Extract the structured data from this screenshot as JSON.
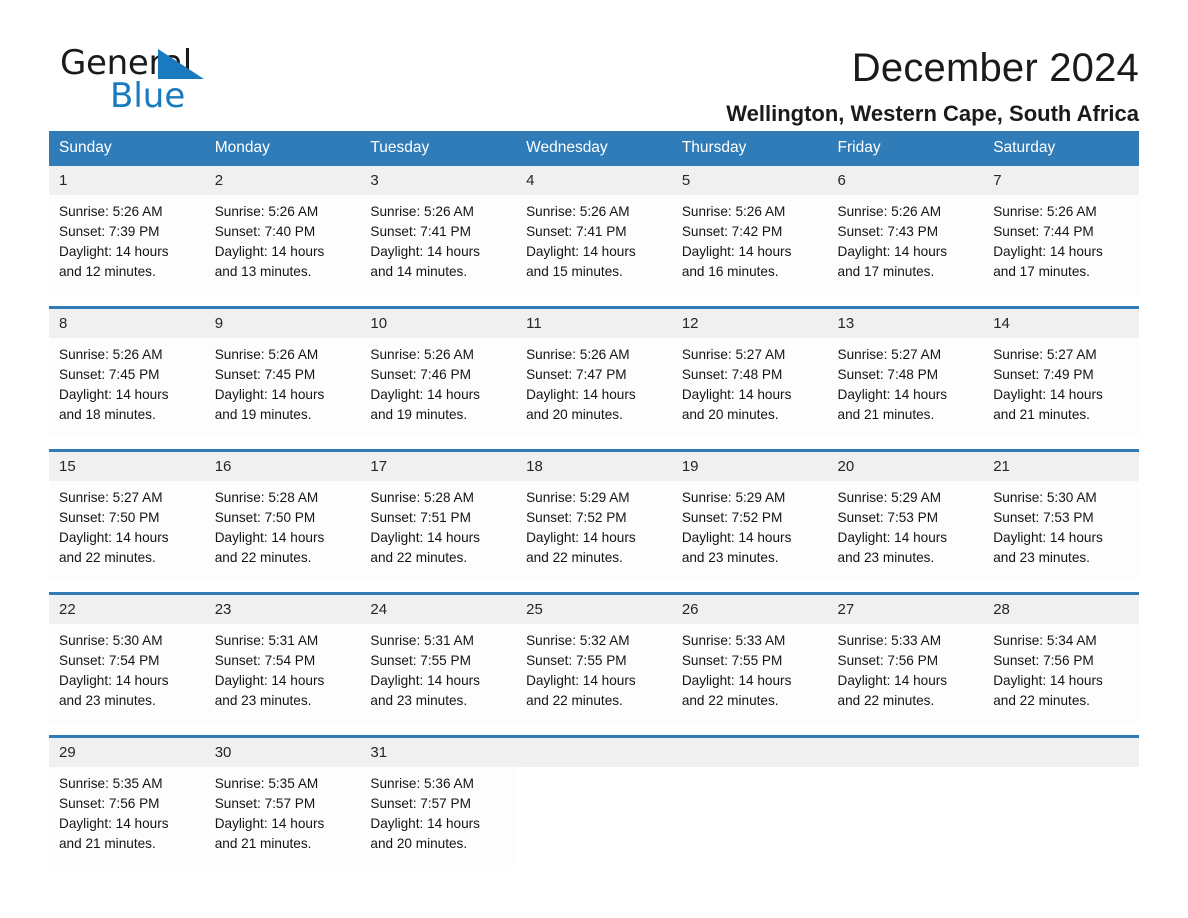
{
  "brand": {
    "name_part1": "General",
    "name_part2": "Blue",
    "logo_icon": "triangle-flag-icon"
  },
  "header": {
    "month_title": "December 2024",
    "location": "Wellington, Western Cape, South Africa"
  },
  "colors": {
    "header_blue": "#2f7cb8",
    "date_band": "#f0f0f0",
    "brand_blue": "#1a7ac0",
    "text": "#141414"
  },
  "weekday_headers": [
    "Sunday",
    "Monday",
    "Tuesday",
    "Wednesday",
    "Thursday",
    "Friday",
    "Saturday"
  ],
  "weeks": [
    {
      "dates": [
        "1",
        "2",
        "3",
        "4",
        "5",
        "6",
        "7"
      ],
      "cells": [
        {
          "sunrise": "Sunrise: 5:26 AM",
          "sunset": "Sunset: 7:39 PM",
          "daylight1": "Daylight: 14 hours",
          "daylight2": "and 12 minutes."
        },
        {
          "sunrise": "Sunrise: 5:26 AM",
          "sunset": "Sunset: 7:40 PM",
          "daylight1": "Daylight: 14 hours",
          "daylight2": "and 13 minutes."
        },
        {
          "sunrise": "Sunrise: 5:26 AM",
          "sunset": "Sunset: 7:41 PM",
          "daylight1": "Daylight: 14 hours",
          "daylight2": "and 14 minutes."
        },
        {
          "sunrise": "Sunrise: 5:26 AM",
          "sunset": "Sunset: 7:41 PM",
          "daylight1": "Daylight: 14 hours",
          "daylight2": "and 15 minutes."
        },
        {
          "sunrise": "Sunrise: 5:26 AM",
          "sunset": "Sunset: 7:42 PM",
          "daylight1": "Daylight: 14 hours",
          "daylight2": "and 16 minutes."
        },
        {
          "sunrise": "Sunrise: 5:26 AM",
          "sunset": "Sunset: 7:43 PM",
          "daylight1": "Daylight: 14 hours",
          "daylight2": "and 17 minutes."
        },
        {
          "sunrise": "Sunrise: 5:26 AM",
          "sunset": "Sunset: 7:44 PM",
          "daylight1": "Daylight: 14 hours",
          "daylight2": "and 17 minutes."
        }
      ]
    },
    {
      "dates": [
        "8",
        "9",
        "10",
        "11",
        "12",
        "13",
        "14"
      ],
      "cells": [
        {
          "sunrise": "Sunrise: 5:26 AM",
          "sunset": "Sunset: 7:45 PM",
          "daylight1": "Daylight: 14 hours",
          "daylight2": "and 18 minutes."
        },
        {
          "sunrise": "Sunrise: 5:26 AM",
          "sunset": "Sunset: 7:45 PM",
          "daylight1": "Daylight: 14 hours",
          "daylight2": "and 19 minutes."
        },
        {
          "sunrise": "Sunrise: 5:26 AM",
          "sunset": "Sunset: 7:46 PM",
          "daylight1": "Daylight: 14 hours",
          "daylight2": "and 19 minutes."
        },
        {
          "sunrise": "Sunrise: 5:26 AM",
          "sunset": "Sunset: 7:47 PM",
          "daylight1": "Daylight: 14 hours",
          "daylight2": "and 20 minutes."
        },
        {
          "sunrise": "Sunrise: 5:27 AM",
          "sunset": "Sunset: 7:48 PM",
          "daylight1": "Daylight: 14 hours",
          "daylight2": "and 20 minutes."
        },
        {
          "sunrise": "Sunrise: 5:27 AM",
          "sunset": "Sunset: 7:48 PM",
          "daylight1": "Daylight: 14 hours",
          "daylight2": "and 21 minutes."
        },
        {
          "sunrise": "Sunrise: 5:27 AM",
          "sunset": "Sunset: 7:49 PM",
          "daylight1": "Daylight: 14 hours",
          "daylight2": "and 21 minutes."
        }
      ]
    },
    {
      "dates": [
        "15",
        "16",
        "17",
        "18",
        "19",
        "20",
        "21"
      ],
      "cells": [
        {
          "sunrise": "Sunrise: 5:27 AM",
          "sunset": "Sunset: 7:50 PM",
          "daylight1": "Daylight: 14 hours",
          "daylight2": "and 22 minutes."
        },
        {
          "sunrise": "Sunrise: 5:28 AM",
          "sunset": "Sunset: 7:50 PM",
          "daylight1": "Daylight: 14 hours",
          "daylight2": "and 22 minutes."
        },
        {
          "sunrise": "Sunrise: 5:28 AM",
          "sunset": "Sunset: 7:51 PM",
          "daylight1": "Daylight: 14 hours",
          "daylight2": "and 22 minutes."
        },
        {
          "sunrise": "Sunrise: 5:29 AM",
          "sunset": "Sunset: 7:52 PM",
          "daylight1": "Daylight: 14 hours",
          "daylight2": "and 22 minutes."
        },
        {
          "sunrise": "Sunrise: 5:29 AM",
          "sunset": "Sunset: 7:52 PM",
          "daylight1": "Daylight: 14 hours",
          "daylight2": "and 23 minutes."
        },
        {
          "sunrise": "Sunrise: 5:29 AM",
          "sunset": "Sunset: 7:53 PM",
          "daylight1": "Daylight: 14 hours",
          "daylight2": "and 23 minutes."
        },
        {
          "sunrise": "Sunrise: 5:30 AM",
          "sunset": "Sunset: 7:53 PM",
          "daylight1": "Daylight: 14 hours",
          "daylight2": "and 23 minutes."
        }
      ]
    },
    {
      "dates": [
        "22",
        "23",
        "24",
        "25",
        "26",
        "27",
        "28"
      ],
      "cells": [
        {
          "sunrise": "Sunrise: 5:30 AM",
          "sunset": "Sunset: 7:54 PM",
          "daylight1": "Daylight: 14 hours",
          "daylight2": "and 23 minutes."
        },
        {
          "sunrise": "Sunrise: 5:31 AM",
          "sunset": "Sunset: 7:54 PM",
          "daylight1": "Daylight: 14 hours",
          "daylight2": "and 23 minutes."
        },
        {
          "sunrise": "Sunrise: 5:31 AM",
          "sunset": "Sunset: 7:55 PM",
          "daylight1": "Daylight: 14 hours",
          "daylight2": "and 23 minutes."
        },
        {
          "sunrise": "Sunrise: 5:32 AM",
          "sunset": "Sunset: 7:55 PM",
          "daylight1": "Daylight: 14 hours",
          "daylight2": "and 22 minutes."
        },
        {
          "sunrise": "Sunrise: 5:33 AM",
          "sunset": "Sunset: 7:55 PM",
          "daylight1": "Daylight: 14 hours",
          "daylight2": "and 22 minutes."
        },
        {
          "sunrise": "Sunrise: 5:33 AM",
          "sunset": "Sunset: 7:56 PM",
          "daylight1": "Daylight: 14 hours",
          "daylight2": "and 22 minutes."
        },
        {
          "sunrise": "Sunrise: 5:34 AM",
          "sunset": "Sunset: 7:56 PM",
          "daylight1": "Daylight: 14 hours",
          "daylight2": "and 22 minutes."
        }
      ]
    },
    {
      "dates": [
        "29",
        "30",
        "31",
        "",
        "",
        "",
        ""
      ],
      "cells": [
        {
          "sunrise": "Sunrise: 5:35 AM",
          "sunset": "Sunset: 7:56 PM",
          "daylight1": "Daylight: 14 hours",
          "daylight2": "and 21 minutes."
        },
        {
          "sunrise": "Sunrise: 5:35 AM",
          "sunset": "Sunset: 7:57 PM",
          "daylight1": "Daylight: 14 hours",
          "daylight2": "and 21 minutes."
        },
        {
          "sunrise": "Sunrise: 5:36 AM",
          "sunset": "Sunset: 7:57 PM",
          "daylight1": "Daylight: 14 hours",
          "daylight2": "and 20 minutes."
        },
        {
          "sunrise": "",
          "sunset": "",
          "daylight1": "",
          "daylight2": ""
        },
        {
          "sunrise": "",
          "sunset": "",
          "daylight1": "",
          "daylight2": ""
        },
        {
          "sunrise": "",
          "sunset": "",
          "daylight1": "",
          "daylight2": ""
        },
        {
          "sunrise": "",
          "sunset": "",
          "daylight1": "",
          "daylight2": ""
        }
      ]
    }
  ]
}
